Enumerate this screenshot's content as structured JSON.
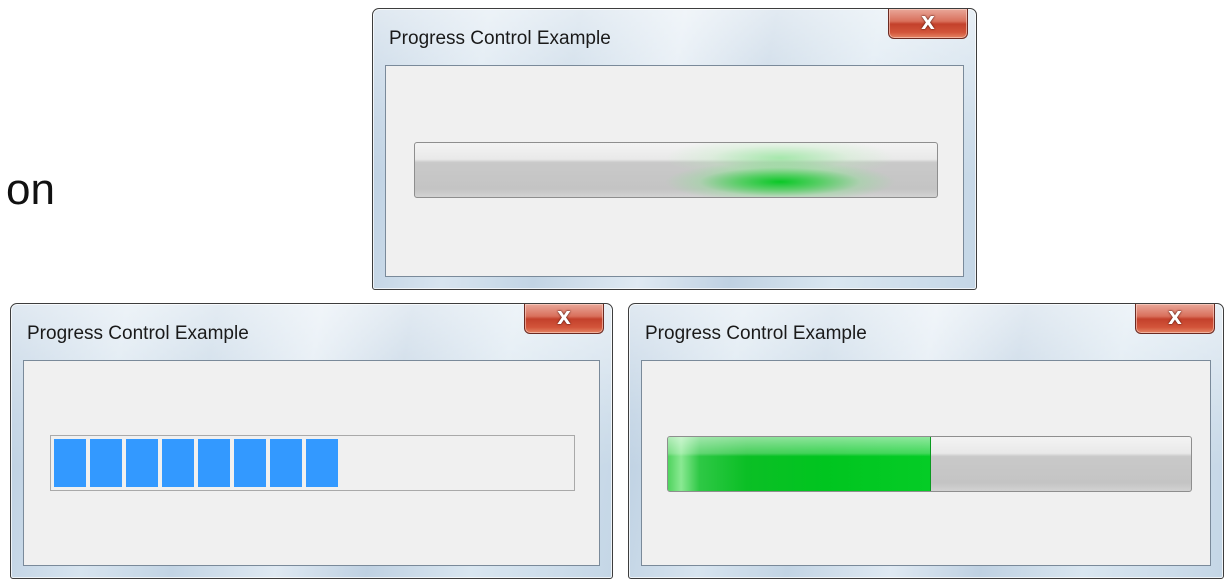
{
  "side_label": "on",
  "windows": [
    {
      "id": "marquee",
      "title": "Progress Control Example",
      "close_glyph": "X",
      "progress_style": "marquee"
    },
    {
      "id": "classic",
      "title": "Progress Control Example",
      "close_glyph": "X",
      "progress_style": "classic-segmented",
      "progress_percent": 55,
      "segment_count": 8,
      "bar_color": "#3399ff"
    },
    {
      "id": "aero",
      "title": "Progress Control Example",
      "close_glyph": "X",
      "progress_style": "aero",
      "progress_percent": 50,
      "bar_color": "#00c51f"
    }
  ],
  "icons": {
    "close": "close-icon"
  }
}
